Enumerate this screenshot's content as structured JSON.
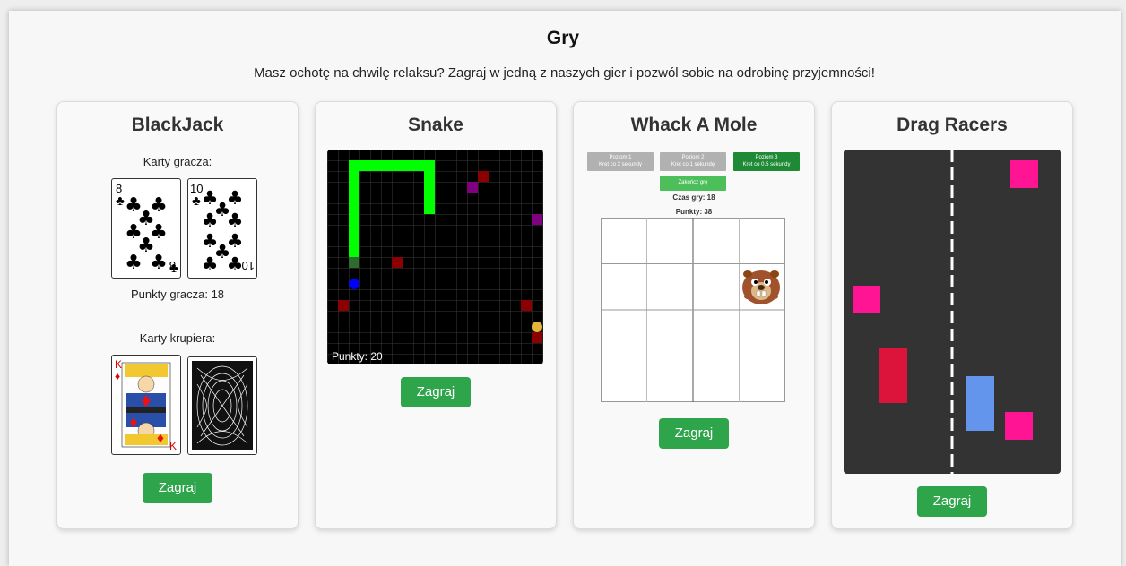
{
  "page": {
    "title": "Gry",
    "subtitle": "Masz ochotę na chwilę relaksu? Zagraj w jedną z naszych gier i pozwól sobie na odrobinę przyjemności!"
  },
  "blackjack": {
    "title": "BlackJack",
    "player_label": "Karty gracza:",
    "player_cards": [
      {
        "rank": "8",
        "suit": "clubs"
      },
      {
        "rank": "10",
        "suit": "clubs"
      }
    ],
    "player_points": "Punkty gracza: 18",
    "dealer_label": "Karty krupiera:",
    "dealer_cards": [
      {
        "rank": "K",
        "suit": "diamonds"
      },
      {
        "rank": "hidden",
        "suit": "back"
      }
    ],
    "play_label": "Zagraj"
  },
  "snake": {
    "title": "Snake",
    "score": "Punkty: 20",
    "play_label": "Zagraj"
  },
  "mole": {
    "title": "Whack A Mole",
    "levels": [
      {
        "label": "Poziom 1",
        "desc": "Kret co 2 sekundy",
        "active": false
      },
      {
        "label": "Poziom 2",
        "desc": "Kret co 1 sekundę",
        "active": false
      },
      {
        "label": "Poziom 3",
        "desc": "Kret co 0.5 sekundy",
        "active": true
      }
    ],
    "end_label": "Zakończ grę",
    "time": "Czas gry: 18",
    "points": "Punkty: 38",
    "play_label": "Zagraj"
  },
  "racers": {
    "title": "Drag Racers",
    "play_label": "Zagraj"
  },
  "colors": {
    "accent": "#2ea54a",
    "snake": "#00ff00",
    "mole_active": "#1f8a36",
    "track": "#333333",
    "car_pink": "#ff1493",
    "car_red": "#dc143c",
    "car_blue": "#6495ed"
  }
}
